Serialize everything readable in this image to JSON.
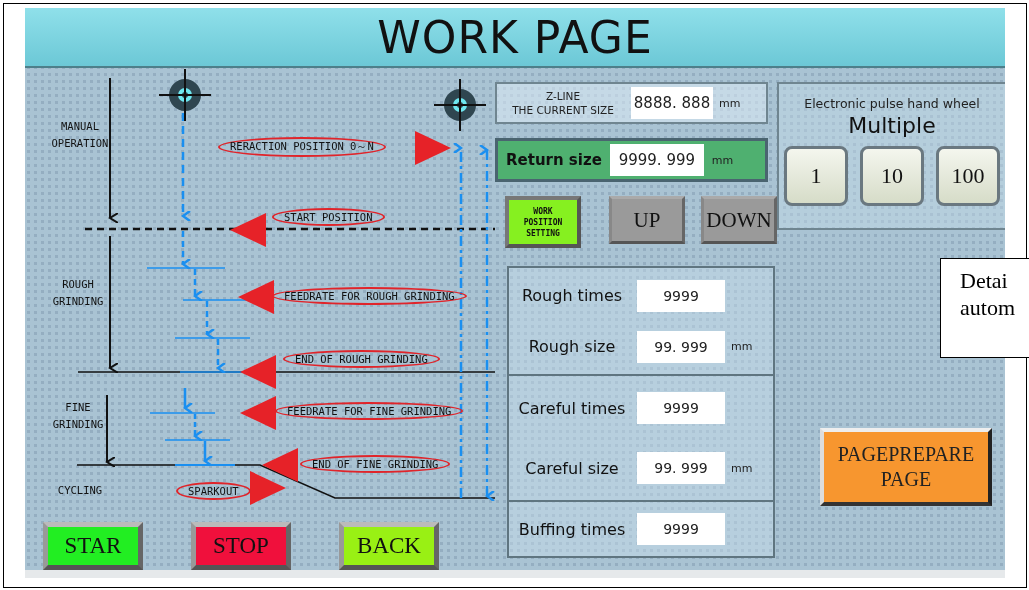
{
  "title": "WORK PAGE",
  "stages": [
    {
      "text": "MANUAL OPERATION"
    },
    {
      "text": "ROUGH GRINDING"
    },
    {
      "text": "FINE GRINDING"
    },
    {
      "text": "CYCLING"
    }
  ],
  "markers": [
    {
      "text": "RERACTION POSITION 0～N",
      "kind": "right"
    },
    {
      "text": "START POSITION",
      "kind": "left"
    },
    {
      "text": "FEEDRATE FOR ROUGH GRINDING",
      "kind": "left"
    },
    {
      "text": "END OF ROUGH GRINDING",
      "kind": "left"
    },
    {
      "text": "FEEDRATE FOR FINE GRINDING",
      "kind": "left"
    },
    {
      "text": "END OF FINE GRINDING",
      "kind": "left"
    },
    {
      "text": "SPARKOUT",
      "kind": "right"
    }
  ],
  "control_buttons": [
    {
      "label": "STAR",
      "kind": "start"
    },
    {
      "label": "STOP",
      "kind": "stop"
    },
    {
      "label": "BACK",
      "kind": "back"
    }
  ],
  "z_line": {
    "label_lines": [
      "Z-LINE",
      "THE CURRENT SIZE"
    ],
    "value": "8888. 888",
    "unit": "mm"
  },
  "return_size": {
    "label": "Return size",
    "value": "9999. 999",
    "unit": "mm"
  },
  "jog_buttons": [
    {
      "label": "WORK POSITION SETTING",
      "kind": "setting"
    },
    {
      "label": "UP",
      "kind": "jog"
    },
    {
      "label": "DOWN",
      "kind": "jog"
    }
  ],
  "parameter_groups": [
    [
      {
        "label": "Rough times",
        "value": "9999"
      },
      {
        "label": "Rough size",
        "value": "99. 999",
        "unit": "mm"
      }
    ],
    [
      {
        "label": "Careful times",
        "value": "9999"
      },
      {
        "label": "Careful size",
        "value": "99. 999",
        "unit": "mm"
      }
    ],
    [
      {
        "label": "Buffing times",
        "value": "9999"
      }
    ]
  ],
  "hand_wheel": {
    "title": "Electronic pulse hand wheel",
    "subtitle": "Multiple",
    "multipliers": [
      "1",
      "10",
      "100"
    ]
  },
  "page_button": {
    "label_lines": [
      "PAGEPREPARE",
      "PAGE"
    ]
  },
  "callout": {
    "lines": [
      "Detai",
      "autom"
    ]
  }
}
